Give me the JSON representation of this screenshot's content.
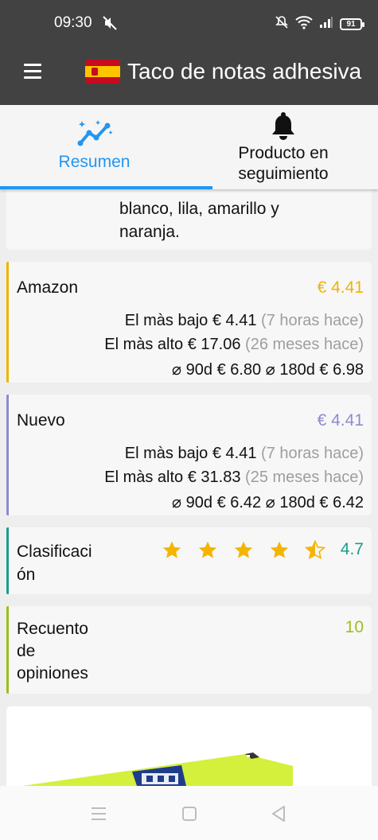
{
  "status_bar": {
    "time": "09:30",
    "battery": "91"
  },
  "app_bar": {
    "title": "Taco de notas adhesiva"
  },
  "tabs": [
    {
      "label": "Resumen",
      "selected": true
    },
    {
      "label_line1": "Producto en",
      "label_line2": "seguimiento",
      "selected": false
    }
  ],
  "description_card": {
    "line1": "blanco, lila, amarillo y",
    "line2": "naranja."
  },
  "amazon_card": {
    "title": "Amazon",
    "price": "€ 4.41",
    "accent": "#f0b400",
    "lowest_label": "El màs bajo",
    "lowest_price": "€ 4.41",
    "lowest_when": "(7 horas hace)",
    "highest_label": "El màs alto",
    "highest_price": "€ 17.06",
    "highest_when": "(26 meses hace)",
    "avg90_label": "⌀ 90d",
    "avg90_value": "€ 6.80",
    "avg180_label": "⌀ 180d",
    "avg180_value": "€ 6.98"
  },
  "new_card": {
    "title": "Nuevo",
    "price": "€ 4.41",
    "accent": "#8c8ccf",
    "lowest_label": "El màs bajo",
    "lowest_price": "€ 4.41",
    "lowest_when": "(7 horas hace)",
    "highest_label": "El màs alto",
    "highest_price": "€ 31.83",
    "highest_when": "(25 meses hace)",
    "avg90_label": "⌀ 90d",
    "avg90_value": "€ 6.42",
    "avg180_label": "⌀ 180d",
    "avg180_value": "€ 6.42"
  },
  "rating_card": {
    "label_line1": "Clasificaci",
    "label_line2": "ón",
    "value": "4.7",
    "stars_filled": 4.7,
    "accent": "#1a9e8c",
    "star_color": "#f5b400"
  },
  "reviews_card": {
    "label_line1": "Recuento",
    "label_line2": "de",
    "label_line3": "opiniones",
    "value": "10",
    "accent": "#9bbf1c"
  }
}
